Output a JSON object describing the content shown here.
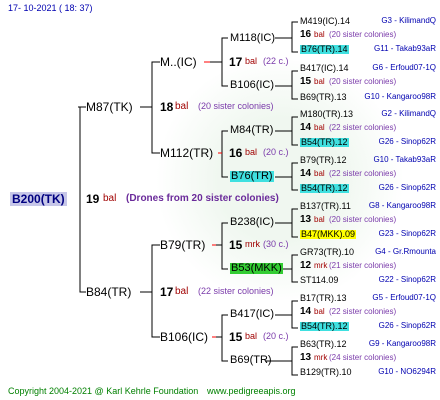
{
  "header": {
    "date": "17-  10-2021  (  18:  37)"
  },
  "footer": {
    "copyright": "Copyright 2004-2021 @ Karl Kehrle Foundation",
    "site": "www.pedigreeapis.org"
  },
  "colors": {
    "root_box": "#c6c6e8",
    "cyan": "#3fe0e0",
    "yellow": "#ffff00",
    "green": "#33cc33",
    "bal": "#a00000",
    "blue": "#0000b0"
  },
  "root": {
    "id": "B200(TK)",
    "year": "19",
    "bal": "bal",
    "note": "(Drones from 20 sister colonies)"
  },
  "gen1": [
    {
      "id": "M87(TK)",
      "year": "18",
      "bal": "bal",
      "note": "(20 sister colonies)"
    },
    {
      "id": "B84(TR)",
      "year": "17",
      "bal": "bal",
      "note": "(22 sister colonies)"
    }
  ],
  "gen2": [
    {
      "id": "M..(IC)"
    },
    {
      "id": "M112(TR)",
      "year": "16",
      "bal": "bal",
      "note": "(20 c.)"
    },
    {
      "id": "B79(TR)",
      "year": "15",
      "bal": "mrk",
      "note": "(30 c.)"
    },
    {
      "id": "B106(IC)",
      "year": "15",
      "bal": "bal",
      "note": "(20 c.)"
    }
  ],
  "gen3": [
    {
      "id": "M118(IC)",
      "year": "17",
      "bal": "bal",
      "note": "(22 c.)"
    },
    {
      "id": "B106(IC)"
    },
    {
      "id": "M84(TR)",
      "year": "16",
      "bal": "bal",
      "note": "(20 c.)"
    },
    {
      "id": "B76(TR)"
    },
    {
      "id": "B238(IC)",
      "year": "13",
      "bal": "bal",
      "note": "(20 c.)"
    },
    {
      "id": "B53(MKK)"
    },
    {
      "id": "B417(IC)",
      "year": "14",
      "bal": "bal",
      "note": "(22 c.)"
    },
    {
      "id": "B69(TR)"
    }
  ],
  "gen4": [
    {
      "id": "M419(IC).14",
      "code": "G3 - KilimandQ"
    },
    {
      "num": "16",
      "bal": "bal",
      "note": "(20 sister colonies)"
    },
    {
      "id": "B76(TR).14",
      "code": "G11 - Takab93aR"
    },
    {
      "id": "B417(IC).14",
      "code": "G6 - Erfoud07-1Q"
    },
    {
      "num": "15",
      "bal": "bal",
      "note": "(20 sister colonies)"
    },
    {
      "id": "B69(TR).13",
      "code": "G10 - Kangaroo98R"
    },
    {
      "id": "M180(TR).13",
      "code": "G2 - KilimandQ"
    },
    {
      "num": "14",
      "bal": "bal",
      "note": "(22 sister colonies)"
    },
    {
      "id": "B54(TR).12",
      "code": "G26 - Sinop62R"
    },
    {
      "id": "B79(TR).12",
      "code": "G10 - Takab93aR"
    },
    {
      "num": "14",
      "bal": "bal",
      "note": "(22 sister colonies)"
    },
    {
      "id": "B54(TR).12",
      "code": "G26 - Sinop62R"
    },
    {
      "id": "B137(TR).11",
      "code": "G8 - Kangaroo98R"
    },
    {
      "num": "13",
      "bal": "bal",
      "note": "(20 sister colonies)"
    },
    {
      "id": "B47(MKK).09",
      "code": "G23 - Sinop62R"
    },
    {
      "id": "GR73(TR).10",
      "code": "G4 - Gr.Rmounta"
    },
    {
      "num": "12",
      "bal": "mrk",
      "note": "(21 sister colonies)"
    },
    {
      "id": "ST114.09",
      "code": "G22 - Sinop62R"
    },
    {
      "id": "B17(TR).13",
      "code": "G5 - Erfoud07-1Q"
    },
    {
      "num": "14",
      "bal": "bal",
      "note": "(22 sister colonies)"
    },
    {
      "id": "B54(TR).12",
      "code": "G26 - Sinop62R"
    },
    {
      "id": "B63(TR).12",
      "code": "G9 - Kangaroo98R"
    },
    {
      "num": "13",
      "bal": "mrk",
      "note": "(24 sister colonies)"
    },
    {
      "id": "B129(TR).10",
      "code": "G10 - NO6294R"
    }
  ]
}
